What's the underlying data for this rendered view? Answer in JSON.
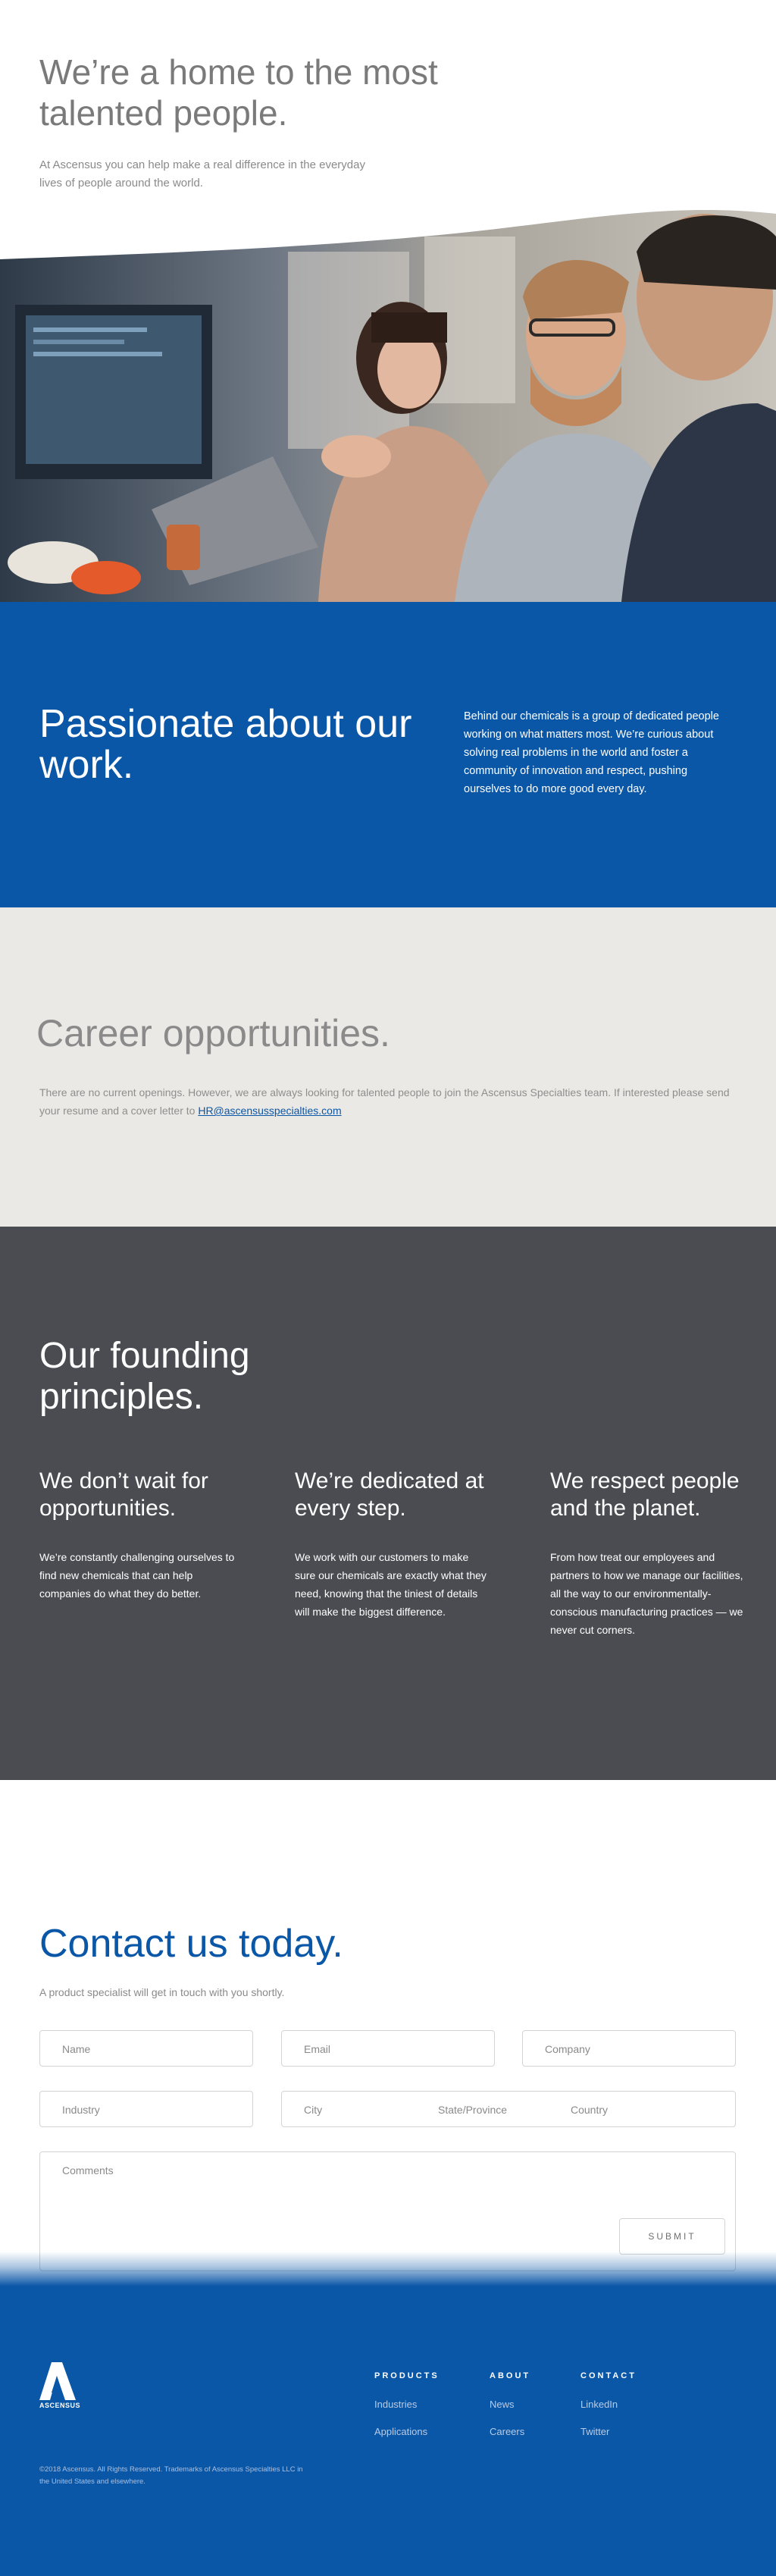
{
  "hero": {
    "title": "We’re a home to the most talented people.",
    "subtitle": "At Ascensus you can help make a real difference in the everyday lives of people around the world."
  },
  "passion": {
    "title": "Passionate about our work.",
    "body": "Behind our chemicals is a group of dedicated people working on what matters most. We’re curious about solving real problems in the world and foster a community of innovation and respect, pushing ourselves to do more good every day."
  },
  "career": {
    "title": "Career opportunities.",
    "body": "There are no current openings. However, we are always looking for talented people to join the Ascensus Specialties team. If interested please send your resume and a cover letter to ",
    "email": "HR@ascensusspecialties.com"
  },
  "principles": {
    "title": "Our founding principles.",
    "items": [
      {
        "heading": "We don’t wait for opportunities.",
        "body": "We’re constantly challenging ourselves to find new chemicals that can help companies do what they do better."
      },
      {
        "heading": "We’re dedicated at every step.",
        "body": "We work with our customers to make sure our chemicals are exactly what they need, knowing that the tiniest of details will make the biggest difference."
      },
      {
        "heading": "We respect people and the planet.",
        "body": "From how treat our employees and partners to how we manage our facilities, all the way to our environmentally-conscious manufacturing practices — we never cut corners."
      }
    ]
  },
  "contact": {
    "title": "Contact us today.",
    "subtitle": "A product specialist will get in touch with you shortly.",
    "fields": {
      "name": "Name",
      "email": "Email",
      "company": "Company",
      "industry": "Industry",
      "city": "City",
      "state": "State/Province",
      "country": "Country",
      "comments": "Comments"
    },
    "submit_label": "SUBMIT"
  },
  "footer": {
    "logo_text": "ASCENSUS",
    "columns": [
      {
        "heading": "PRODUCTS",
        "links": [
          "Industries",
          "Applications"
        ]
      },
      {
        "heading": "ABOUT",
        "links": [
          "News",
          "Careers"
        ]
      },
      {
        "heading": "CONTACT",
        "links": [
          "LinkedIn",
          "Twitter"
        ]
      }
    ],
    "copyright": "©2018 Ascensus. All Rights Reserved. Trademarks of Ascensus Specialties LLC in the United States and elsewhere."
  },
  "colors": {
    "brand_blue": "#0a56a7",
    "dark_gray": "#4b4c51",
    "light_beige": "#ebe9e5"
  }
}
